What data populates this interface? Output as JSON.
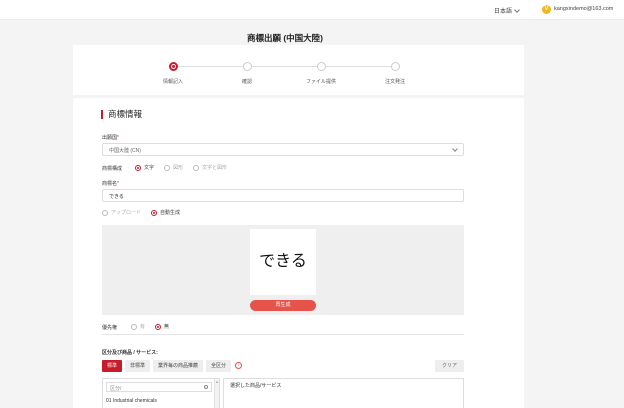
{
  "topbar": {
    "language": "日本語",
    "user_email": "kangxindemo@163.com",
    "user_icon": "V"
  },
  "page": {
    "title": "商標出願 (中国大陸)"
  },
  "steps": [
    {
      "label": "情報記入",
      "active": true
    },
    {
      "label": "確認",
      "active": false
    },
    {
      "label": "ファイル提供",
      "active": false
    },
    {
      "label": "注文発注",
      "active": false
    }
  ],
  "form": {
    "section_title": "商標情報",
    "country_label": "出願国",
    "country_value": "中国大陸 (CN)",
    "trademark_type_label": "商標構成",
    "trademark_type_options": [
      "文字",
      "図形",
      "文字と図形"
    ],
    "trademark_name_label": "商標名",
    "trademark_name_value": "できる",
    "image_source_options": [
      "アップロード",
      "自動生成"
    ],
    "preview_text": "できる",
    "regenerate_label": "再生成",
    "priority_label": "優先権",
    "priority_options": [
      "有",
      "無"
    ],
    "goods_label": "区分及び商品 / サービス:",
    "goods_tabs": [
      "標準",
      "非標準",
      "業界毎の商品推薦",
      "全区分"
    ],
    "clear_label": "クリア",
    "class_search_placeholder": "区分/ ",
    "class_items": [
      "01 Industrial chemicals"
    ],
    "selected_goods_label": "選択した商品/サービス"
  },
  "icons": {
    "language_chevron": "chevron-down-icon",
    "country_chevron": "chevron-down-icon",
    "info": "info-icon",
    "search": "search-icon"
  },
  "colors": {
    "accent": "#c51b2b",
    "button_red": "#e5534b"
  }
}
